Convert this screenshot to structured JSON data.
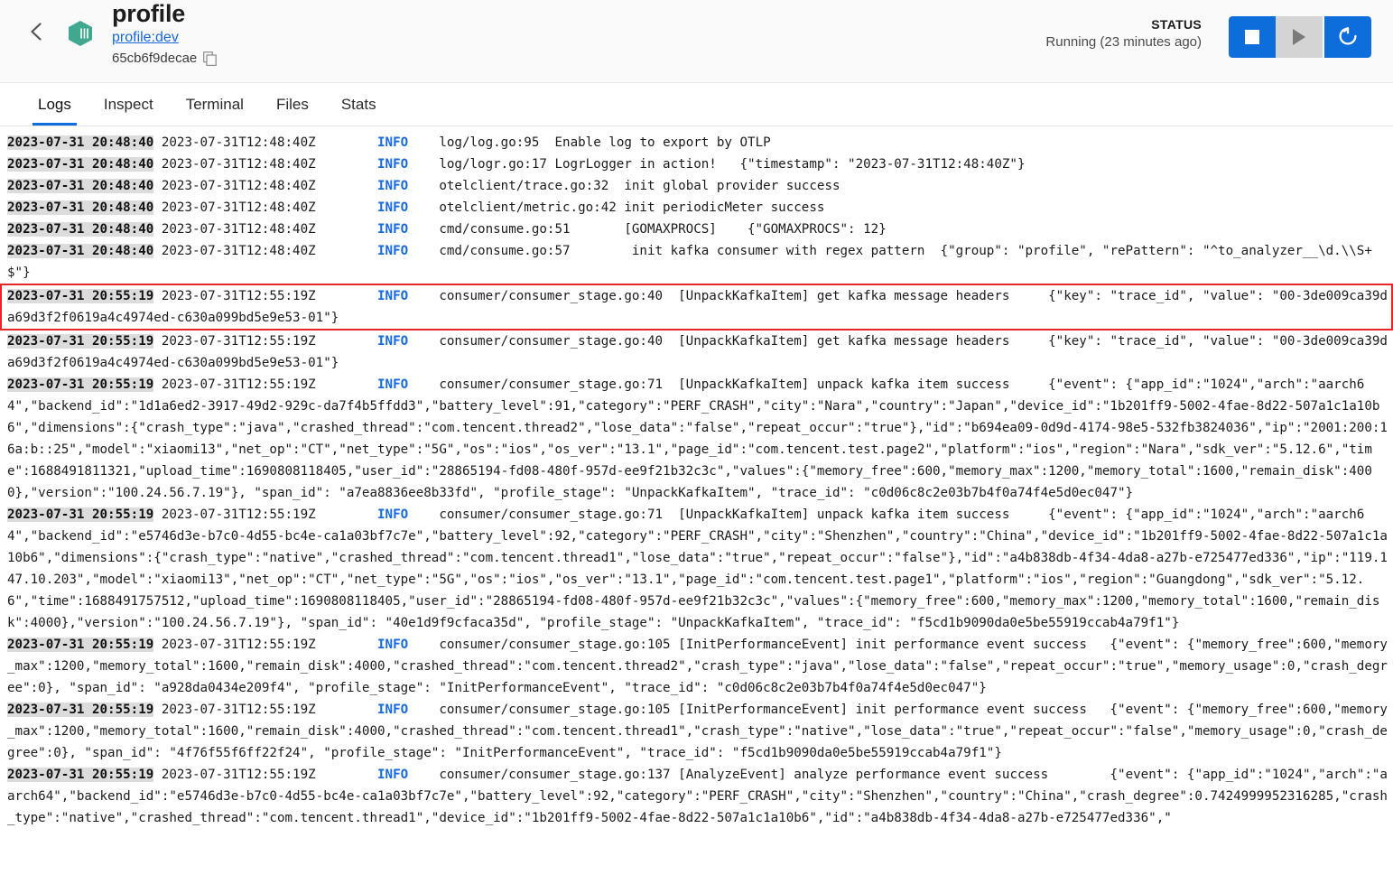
{
  "header": {
    "back_icon": "chevron-left-icon",
    "container_icon": "cube-icon",
    "title": "profile",
    "image_link": "profile:dev",
    "container_id": "65cb6f9decae",
    "copy_icon": "copy-icon",
    "status_label": "STATUS",
    "status_value": "Running (23 minutes ago)",
    "stop_label": "stop-icon",
    "start_label": "play-icon",
    "restart_label": "restart-icon",
    "accent_color": "#0d6ddb",
    "link_color": "#1668dc",
    "cube_color": "#3fa88f"
  },
  "tabs": [
    {
      "label": "Logs",
      "active": true
    },
    {
      "label": "Inspect",
      "active": false
    },
    {
      "label": "Terminal",
      "active": false
    },
    {
      "label": "Files",
      "active": false
    },
    {
      "label": "Stats",
      "active": false
    }
  ],
  "logs": {
    "highlight_color": "#e8262a",
    "timestamp_highlight_color": "#dcdcdc",
    "level_color": "#1668dc",
    "entries": [
      {
        "id": 1,
        "highlighted": false,
        "local_time": "2023-07-31 20:48:40",
        "utc_time": "2023-07-31T12:48:40Z",
        "level": "INFO",
        "source": "log/log.go:95",
        "message": "  Enable log to export by OTLP"
      },
      {
        "id": 2,
        "highlighted": false,
        "local_time": "2023-07-31 20:48:40",
        "utc_time": "2023-07-31T12:48:40Z",
        "level": "INFO",
        "source": "log/logr.go:17",
        "message": " LogrLogger in action!   {\"timestamp\": \"2023-07-31T12:48:40Z\"}"
      },
      {
        "id": 3,
        "highlighted": false,
        "local_time": "2023-07-31 20:48:40",
        "utc_time": "2023-07-31T12:48:40Z",
        "level": "INFO",
        "source": "otelclient/trace.go:32",
        "message": "  init global provider success"
      },
      {
        "id": 4,
        "highlighted": false,
        "local_time": "2023-07-31 20:48:40",
        "utc_time": "2023-07-31T12:48:40Z",
        "level": "INFO",
        "source": "otelclient/metric.go:42",
        "message": " init periodicMeter success"
      },
      {
        "id": 5,
        "highlighted": false,
        "local_time": "2023-07-31 20:48:40",
        "utc_time": "2023-07-31T12:48:40Z",
        "level": "INFO",
        "source": "cmd/consume.go:51",
        "message": "       [GOMAXPROCS]    {\"GOMAXPROCS\": 12}"
      },
      {
        "id": 6,
        "highlighted": false,
        "local_time": "2023-07-31 20:48:40",
        "utc_time": "2023-07-31T12:48:40Z",
        "level": "INFO",
        "source": "cmd/consume.go:57",
        "message": "        init kafka consumer with regex pattern  {\"group\": \"profile\", \"rePattern\": \"^to_analyzer__\\d.\\\\S+$\"}"
      },
      {
        "id": 7,
        "highlighted": true,
        "local_time": "2023-07-31 20:55:19",
        "utc_time": "2023-07-31T12:55:19Z",
        "level": "INFO",
        "source": "consumer/consumer_stage.go:40",
        "message": "  [UnpackKafkaItem] get kafka message headers     {\"key\": \"trace_id\", \"value\": \"00-3de009ca39da69d3f2f0619a4c4974ed-c630a099bd5e9e53-01\"}"
      },
      {
        "id": 8,
        "highlighted": false,
        "local_time": "2023-07-31 20:55:19",
        "utc_time": "2023-07-31T12:55:19Z",
        "level": "INFO",
        "source": "consumer/consumer_stage.go:40",
        "message": "  [UnpackKafkaItem] get kafka message headers     {\"key\": \"trace_id\", \"value\": \"00-3de009ca39da69d3f2f0619a4c4974ed-c630a099bd5e9e53-01\"}"
      },
      {
        "id": 9,
        "highlighted": false,
        "local_time": "2023-07-31 20:55:19",
        "utc_time": "2023-07-31T12:55:19Z",
        "level": "INFO",
        "source": "consumer/consumer_stage.go:71",
        "message": "  [UnpackKafkaItem] unpack kafka item success     {\"event\": {\"app_id\":\"1024\",\"arch\":\"aarch64\",\"backend_id\":\"1d1a6ed2-3917-49d2-929c-da7f4b5ffdd3\",\"battery_level\":91,\"category\":\"PERF_CRASH\",\"city\":\"Nara\",\"country\":\"Japan\",\"device_id\":\"1b201ff9-5002-4fae-8d22-507a1c1a10b6\",\"dimensions\":{\"crash_type\":\"java\",\"crashed_thread\":\"com.tencent.thread2\",\"lose_data\":\"false\",\"repeat_occur\":\"true\"},\"id\":\"b694ea09-0d9d-4174-98e5-532fb3824036\",\"ip\":\"2001:200:16a:b::25\",\"model\":\"xiaomi13\",\"net_op\":\"CT\",\"net_type\":\"5G\",\"os\":\"ios\",\"os_ver\":\"13.1\",\"page_id\":\"com.tencent.test.page2\",\"platform\":\"ios\",\"region\":\"Nara\",\"sdk_ver\":\"5.12.6\",\"time\":1688491811321,\"upload_time\":1690808118405,\"user_id\":\"28865194-fd08-480f-957d-ee9f21b32c3c\",\"values\":{\"memory_free\":600,\"memory_max\":1200,\"memory_total\":1600,\"remain_disk\":4000},\"version\":\"100.24.56.7.19\"}, \"span_id\": \"a7ea8836ee8b33fd\", \"profile_stage\": \"UnpackKafkaItem\", \"trace_id\": \"c0d06c8c2e03b7b4f0a74f4e5d0ec047\"}"
      },
      {
        "id": 10,
        "highlighted": false,
        "local_time": "2023-07-31 20:55:19",
        "utc_time": "2023-07-31T12:55:19Z",
        "level": "INFO",
        "source": "consumer/consumer_stage.go:71",
        "message": "  [UnpackKafkaItem] unpack kafka item success     {\"event\": {\"app_id\":\"1024\",\"arch\":\"aarch64\",\"backend_id\":\"e5746d3e-b7c0-4d55-bc4e-ca1a03bf7c7e\",\"battery_level\":92,\"category\":\"PERF_CRASH\",\"city\":\"Shenzhen\",\"country\":\"China\",\"device_id\":\"1b201ff9-5002-4fae-8d22-507a1c1a10b6\",\"dimensions\":{\"crash_type\":\"native\",\"crashed_thread\":\"com.tencent.thread1\",\"lose_data\":\"true\",\"repeat_occur\":\"false\"},\"id\":\"a4b838db-4f34-4da8-a27b-e725477ed336\",\"ip\":\"119.147.10.203\",\"model\":\"xiaomi13\",\"net_op\":\"CT\",\"net_type\":\"5G\",\"os\":\"ios\",\"os_ver\":\"13.1\",\"page_id\":\"com.tencent.test.page1\",\"platform\":\"ios\",\"region\":\"Guangdong\",\"sdk_ver\":\"5.12.6\",\"time\":1688491757512,\"upload_time\":1690808118405,\"user_id\":\"28865194-fd08-480f-957d-ee9f21b32c3c\",\"values\":{\"memory_free\":600,\"memory_max\":1200,\"memory_total\":1600,\"remain_disk\":4000},\"version\":\"100.24.56.7.19\"}, \"span_id\": \"40e1d9f9cfaca35d\", \"profile_stage\": \"UnpackKafkaItem\", \"trace_id\": \"f5cd1b9090da0e5be55919ccab4a79f1\"}"
      },
      {
        "id": 11,
        "highlighted": false,
        "local_time": "2023-07-31 20:55:19",
        "utc_time": "2023-07-31T12:55:19Z",
        "level": "INFO",
        "source": "consumer/consumer_stage.go:105",
        "message": " [InitPerformanceEvent] init performance event success   {\"event\": {\"memory_free\":600,\"memory_max\":1200,\"memory_total\":1600,\"remain_disk\":4000,\"crashed_thread\":\"com.tencent.thread2\",\"crash_type\":\"java\",\"lose_data\":\"false\",\"repeat_occur\":\"true\",\"memory_usage\":0,\"crash_degree\":0}, \"span_id\": \"a928da0434e209f4\", \"profile_stage\": \"InitPerformanceEvent\", \"trace_id\": \"c0d06c8c2e03b7b4f0a74f4e5d0ec047\"}"
      },
      {
        "id": 12,
        "highlighted": false,
        "local_time": "2023-07-31 20:55:19",
        "utc_time": "2023-07-31T12:55:19Z",
        "level": "INFO",
        "source": "consumer/consumer_stage.go:105",
        "message": " [InitPerformanceEvent] init performance event success   {\"event\": {\"memory_free\":600,\"memory_max\":1200,\"memory_total\":1600,\"remain_disk\":4000,\"crashed_thread\":\"com.tencent.thread1\",\"crash_type\":\"native\",\"lose_data\":\"true\",\"repeat_occur\":\"false\",\"memory_usage\":0,\"crash_degree\":0}, \"span_id\": \"4f76f55f6ff22f24\", \"profile_stage\": \"InitPerformanceEvent\", \"trace_id\": \"f5cd1b9090da0e5be55919ccab4a79f1\"}"
      },
      {
        "id": 13,
        "highlighted": false,
        "local_time": "2023-07-31 20:55:19",
        "utc_time": "2023-07-31T12:55:19Z",
        "level": "INFO",
        "source": "consumer/consumer_stage.go:137",
        "message": " [AnalyzeEvent] analyze performance event success        {\"event\": {\"app_id\":\"1024\",\"arch\":\"aarch64\",\"backend_id\":\"e5746d3e-b7c0-4d55-bc4e-ca1a03bf7c7e\",\"battery_level\":92,\"category\":\"PERF_CRASH\",\"city\":\"Shenzhen\",\"country\":\"China\",\"crash_degree\":0.7424999952316285,\"crash_type\":\"native\",\"crashed_thread\":\"com.tencent.thread1\",\"device_id\":\"1b201ff9-5002-4fae-8d22-507a1c1a10b6\",\"id\":\"a4b838db-4f34-4da8-a27b-e725477ed336\",\""
      }
    ]
  }
}
